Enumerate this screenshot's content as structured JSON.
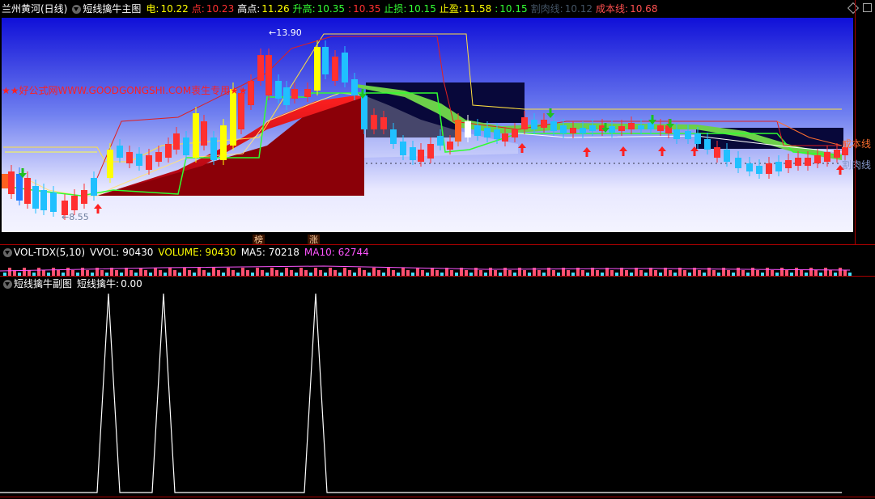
{
  "header": {
    "stock": "兰州黄河(日线)",
    "indicator": "短线擒牛主图",
    "items": [
      {
        "label": "电: ",
        "value": "10.22",
        "label_color": "#ffff00",
        "value_color": "#ffff00"
      },
      {
        "label": "点: ",
        "value": "10.23",
        "label_color": "#ff3030",
        "value_color": "#ff3030"
      },
      {
        "label": "高点: ",
        "value": "11.26",
        "label_color": "#ffffff",
        "value_color": "#ffff00"
      },
      {
        "label": "升高: ",
        "value": "10.35",
        "label_color": "#33ff33",
        "value_color": "#33ff33"
      },
      {
        "label": ": ",
        "value": "10.35",
        "label_color": "#ff3030",
        "value_color": "#ff3030"
      },
      {
        "label": "止损: ",
        "value": "10.15",
        "label_color": "#33ff33",
        "value_color": "#33ff33"
      },
      {
        "label": "止盈: ",
        "value": "11.58",
        "label_color": "#ffff00",
        "value_color": "#ffff00"
      },
      {
        "label": ": ",
        "value": "10.15",
        "label_color": "#33ff33",
        "value_color": "#33ff33"
      },
      {
        "label": "割肉线: ",
        "value": "10.12",
        "label_color": "#445566",
        "value_color": "#445566"
      },
      {
        "label": "成本线: ",
        "value": "10.68",
        "label_color": "#ff5050",
        "value_color": "#ff5050"
      }
    ]
  },
  "main_chart": {
    "watermark": "★★好公式网WWW.GOODGONGSHI.COM衷生专用★★",
    "high_label": "13.90",
    "low_label": "8.55",
    "right_label_cost": "成本线",
    "right_label_cut": "割肉线",
    "tag_bang": "榜",
    "tag_zhang": "涨"
  },
  "volume": {
    "indicator": "VOL-TDX(5,10)",
    "items": [
      {
        "label": "VVOL: ",
        "value": "90430",
        "color": "#ffffff"
      },
      {
        "label": "VOLUME: ",
        "value": "90430",
        "color": "#ffff00"
      },
      {
        "label": "MA5: ",
        "value": "70218",
        "color": "#ffffff"
      },
      {
        "label": "MA10: ",
        "value": "62744",
        "color": "#ff55ff"
      }
    ]
  },
  "sub": {
    "indicator": "短线擒牛副图",
    "label": "短线擒牛: ",
    "value": "0.00"
  }
}
